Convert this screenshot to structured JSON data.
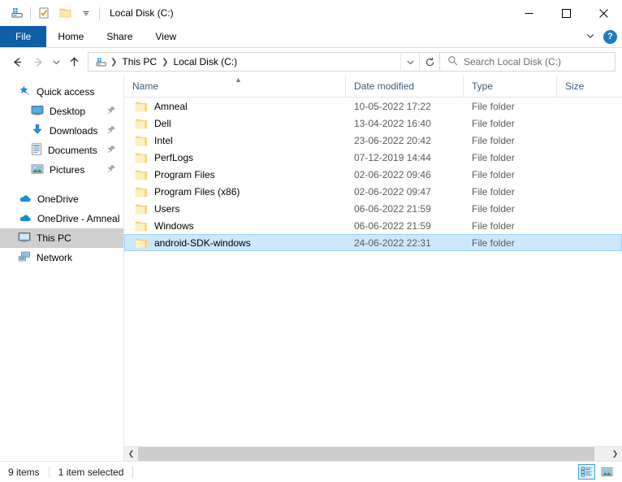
{
  "window": {
    "title": "Local Disk (C:)",
    "quick_access_toolbar": [
      "this-pc-icon",
      "properties-icon",
      "new-folder-icon",
      "customize-dropdown-icon"
    ],
    "controls": {
      "minimize": "─",
      "maximize": "☐",
      "close": "✕"
    }
  },
  "ribbon": {
    "tabs": [
      {
        "label": "File",
        "active": true
      },
      {
        "label": "Home",
        "active": false
      },
      {
        "label": "Share",
        "active": false
      },
      {
        "label": "View",
        "active": false
      }
    ],
    "collapse_icon": "chevron-down-icon",
    "help_label": "?"
  },
  "address": {
    "back_icon": "back-arrow-icon",
    "forward_icon": "forward-arrow-icon",
    "recent_icon": "chevron-down-icon",
    "up_icon": "up-arrow-icon",
    "breadcrumbs": [
      "This PC",
      "Local Disk (C:)"
    ],
    "dropdown_icon": "chevron-down-icon",
    "refresh_icon": "refresh-icon",
    "search_placeholder": "Search Local Disk (C:)",
    "search_value": ""
  },
  "sidebar": {
    "items": [
      {
        "label": "Quick access",
        "icon": "star-pin-icon",
        "child": false,
        "pinned": false,
        "selected": false
      },
      {
        "label": "Desktop",
        "icon": "desktop-icon",
        "child": true,
        "pinned": true,
        "selected": false
      },
      {
        "label": "Downloads",
        "icon": "downloads-icon",
        "child": true,
        "pinned": true,
        "selected": false
      },
      {
        "label": "Documents",
        "icon": "documents-icon",
        "child": true,
        "pinned": true,
        "selected": false
      },
      {
        "label": "Pictures",
        "icon": "pictures-icon",
        "child": true,
        "pinned": true,
        "selected": false
      },
      {
        "label": "OneDrive",
        "icon": "cloud-icon",
        "child": false,
        "pinned": false,
        "selected": false
      },
      {
        "label": "OneDrive - Amneal",
        "icon": "cloud-icon",
        "child": false,
        "pinned": false,
        "selected": false
      },
      {
        "label": "This PC",
        "icon": "this-pc-icon",
        "child": false,
        "pinned": false,
        "selected": true
      },
      {
        "label": "Network",
        "icon": "network-icon",
        "child": false,
        "pinned": false,
        "selected": false
      }
    ]
  },
  "file_list": {
    "columns": [
      "Name",
      "Date modified",
      "Type",
      "Size"
    ],
    "sort_column": "Name",
    "sort_direction": "ascending",
    "rows": [
      {
        "name": "Amneal",
        "date": "10-05-2022 17:22",
        "type": "File folder",
        "size": "",
        "selected": false
      },
      {
        "name": "Dell",
        "date": "13-04-2022 16:40",
        "type": "File folder",
        "size": "",
        "selected": false
      },
      {
        "name": "Intel",
        "date": "23-06-2022 20:42",
        "type": "File folder",
        "size": "",
        "selected": false
      },
      {
        "name": "PerfLogs",
        "date": "07-12-2019 14:44",
        "type": "File folder",
        "size": "",
        "selected": false
      },
      {
        "name": "Program Files",
        "date": "02-06-2022 09:46",
        "type": "File folder",
        "size": "",
        "selected": false
      },
      {
        "name": "Program Files (x86)",
        "date": "02-06-2022 09:47",
        "type": "File folder",
        "size": "",
        "selected": false
      },
      {
        "name": "Users",
        "date": "06-06-2022 21:59",
        "type": "File folder",
        "size": "",
        "selected": false
      },
      {
        "name": "Windows",
        "date": "06-06-2022 21:59",
        "type": "File folder",
        "size": "",
        "selected": false
      },
      {
        "name": "android-SDK-windows",
        "date": "24-06-2022 22:31",
        "type": "File folder",
        "size": "",
        "selected": true
      }
    ]
  },
  "statusbar": {
    "item_count": "9 items",
    "selection": "1 item selected",
    "views": [
      {
        "name": "details-view",
        "active": true
      },
      {
        "name": "large-icons-view",
        "active": false
      }
    ]
  },
  "colors": {
    "accent": "#0d5fa6",
    "selection_fill": "#cce8ff",
    "selection_border": "#99d1ff",
    "folder_yellow": "#fde9a9",
    "column_header_text": "#3c5a78"
  }
}
